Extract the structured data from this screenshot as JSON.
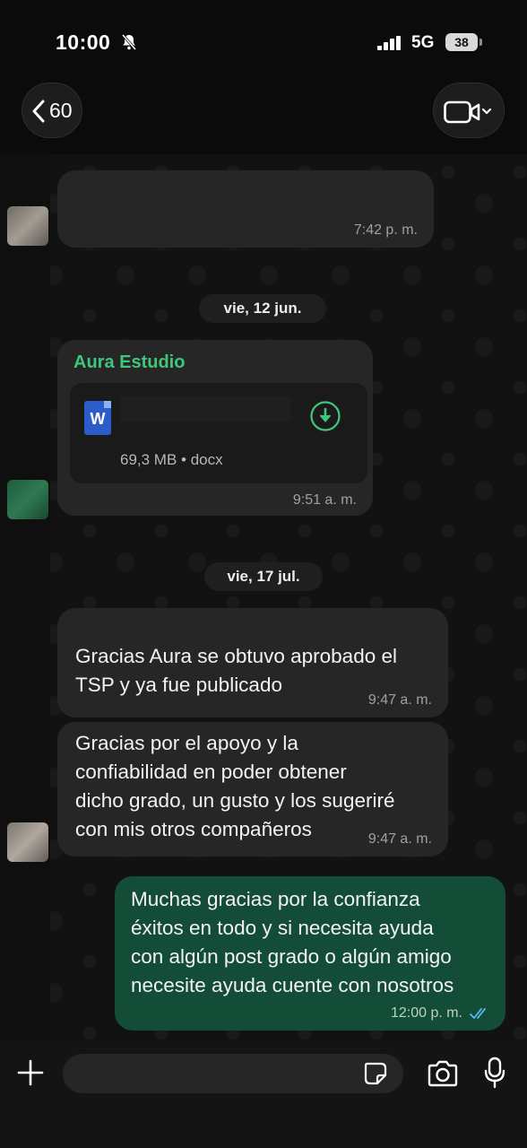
{
  "status_bar": {
    "time": "10:00",
    "network": "5G",
    "battery": "38"
  },
  "header": {
    "back_count": "60"
  },
  "messages": [
    {
      "time": "7:42 p. m."
    },
    {
      "date": "vie, 12 jun."
    },
    {
      "sender": "Aura Estudio",
      "doc_meta": "69,3 MB • docx",
      "doc_icon_letter": "W",
      "time": "9:51 a. m."
    },
    {
      "date": "vie, 17 jul."
    },
    {
      "lines": [
        "Gracias Aura se obtuvo aprobado el",
        "TSP y ya fue publicado"
      ],
      "time": "9:47 a. m."
    },
    {
      "lines": [
        "Gracias por el apoyo y la",
        "confiabilidad en poder obtener",
        "dicho grado, un gusto y los sugeriré",
        "con mis otros compañeros"
      ],
      "time": "9:47 a. m."
    },
    {
      "lines": [
        "Muchas gracias por la confianza",
        "éxitos en todo y si necesita ayuda",
        "con algún post grado o algún amigo",
        "necesite ayuda cuente con nosotros"
      ],
      "time": "12:00 p. m.",
      "read": true
    }
  ],
  "colors": {
    "sender": "#3ec77a",
    "outgoing_bubble": "#144d37",
    "incoming_bubble": "#262626",
    "read_ticks": "#53bdeb"
  },
  "icons": [
    "bell-slash-icon",
    "signal-icon",
    "chevron-left-icon",
    "video-camera-icon",
    "word-doc-icon",
    "download-icon",
    "double-check-icon",
    "plus-icon",
    "sticker-icon",
    "camera-icon",
    "microphone-icon"
  ]
}
